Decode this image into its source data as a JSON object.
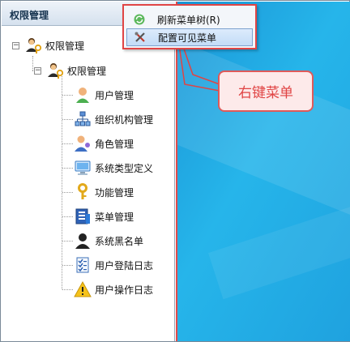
{
  "panel": {
    "title": "权限管理"
  },
  "tree": {
    "root": {
      "label": "权限管理",
      "icon": "users-key-icon",
      "toggle": "−"
    },
    "group": {
      "label": "权限管理",
      "icon": "users-key-icon",
      "toggle": "−"
    },
    "items": [
      {
        "label": "用户管理",
        "icon": "user-icon"
      },
      {
        "label": "组织机构管理",
        "icon": "org-chart-icon"
      },
      {
        "label": "角色管理",
        "icon": "role-icon"
      },
      {
        "label": "系统类型定义",
        "icon": "computer-icon"
      },
      {
        "label": "功能管理",
        "icon": "key-icon"
      },
      {
        "label": "菜单管理",
        "icon": "menu-icon"
      },
      {
        "label": "系统黑名单",
        "icon": "black-user-icon"
      },
      {
        "label": "用户登陆日志",
        "icon": "checklist-icon"
      },
      {
        "label": "用户操作日志",
        "icon": "warning-icon"
      }
    ]
  },
  "context_menu": {
    "items": [
      {
        "label": "刷新菜单树(R)",
        "icon": "refresh-icon"
      },
      {
        "label": "配置可见菜单",
        "icon": "tools-icon",
        "highlighted": true
      }
    ]
  },
  "annotation": {
    "text": "右键菜单"
  },
  "colors": {
    "annotation": "#e04444",
    "desktop": "#1fa2df",
    "menu_highlight": "#c3dcf7"
  }
}
